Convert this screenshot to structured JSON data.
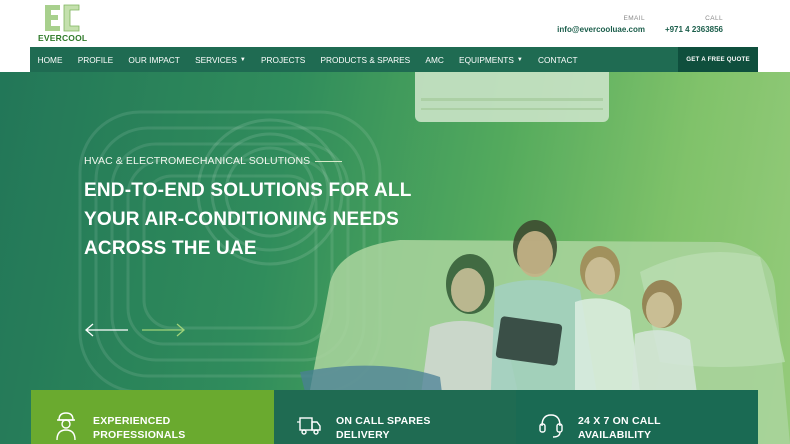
{
  "brand": {
    "logo_monogram": "EC",
    "logo_word": "EVERCOOL"
  },
  "header": {
    "email_label": "EMAIL",
    "email_value": "info@evercooluae.com",
    "call_label": "CALL",
    "call_value": "+971 4 2363856"
  },
  "nav": {
    "items": [
      {
        "label": "HOME"
      },
      {
        "label": "PROFILE"
      },
      {
        "label": "OUR IMPACT"
      },
      {
        "label": "SERVICES",
        "has_dropdown": true
      },
      {
        "label": "PROJECTS"
      },
      {
        "label": "PRODUCTS & SPARES"
      },
      {
        "label": "AMC"
      },
      {
        "label": "EQUIPMENTS",
        "has_dropdown": true
      },
      {
        "label": "CONTACT"
      }
    ],
    "cta_label": "GET A FREE QUOTE"
  },
  "hero": {
    "eyebrow": "HVAC & ELECTROMECHANICAL SOLUTIONS",
    "headline_lines": [
      "END-TO-END SOLUTIONS FOR ALL",
      "YOUR AIR-CONDITIONING NEEDS",
      "ACROSS THE UAE"
    ]
  },
  "features": [
    {
      "line1": "EXPERIENCED",
      "line2": "PROFESSIONALS",
      "icon": "technician-icon"
    },
    {
      "line1": "ON CALL SPARES",
      "line2": "DELIVERY",
      "icon": "delivery-truck-icon"
    },
    {
      "line1": "24 X 7 ON CALL",
      "line2": "AVAILABILITY",
      "icon": "headset-icon"
    }
  ],
  "colors": {
    "nav_bg": "#1f6b52",
    "cta_bg": "#0f4f3d",
    "tile_green": "#6aaa2f",
    "tile_teal": "#1f6b52",
    "brand_green": "#2f7a2a"
  }
}
